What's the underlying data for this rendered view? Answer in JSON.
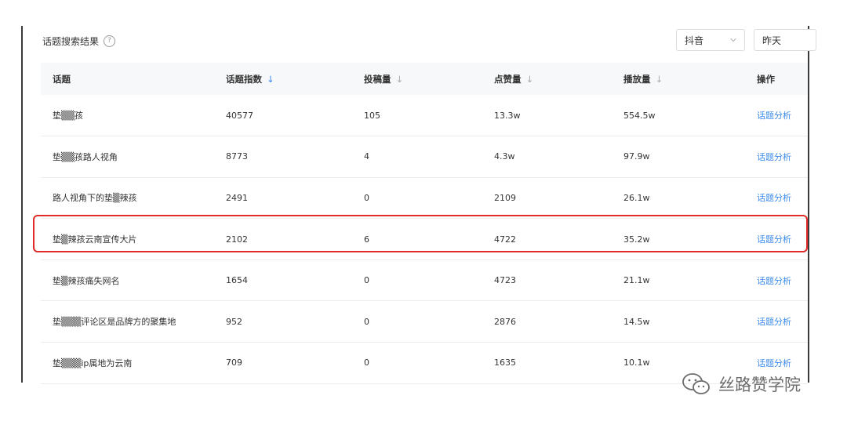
{
  "header": {
    "title": "话题搜索结果",
    "help_glyph": "?"
  },
  "filters": {
    "platform": "抖音",
    "date": "昨天"
  },
  "table": {
    "columns": [
      "话题",
      "话题指数",
      "投稿量",
      "点赞量",
      "播放量",
      "操作"
    ],
    "sort_glyph": "↓",
    "rows": [
      [
        "垫▒▒孩",
        "40577",
        "105",
        "13.3w",
        "554.5w",
        "话题分析"
      ],
      [
        "垫▒▒孩路人视角",
        "8773",
        "4",
        "4.3w",
        "97.9w",
        "话题分析"
      ],
      [
        "路人视角下的垫▒辣孩",
        "2491",
        "0",
        "2109",
        "26.1w",
        "话题分析"
      ],
      [
        "垫▒辣孩云南宣传大片",
        "2102",
        "6",
        "4722",
        "35.2w",
        "话题分析"
      ],
      [
        "垫▒辣孩痛失网名",
        "1654",
        "0",
        "4723",
        "21.1w",
        "话题分析"
      ],
      [
        "垫▒▒▒评论区是品牌方的聚集地",
        "952",
        "0",
        "2876",
        "14.5w",
        "话题分析"
      ],
      [
        "垫▒▒▒ip属地为云南",
        "709",
        "0",
        "1635",
        "10.1w",
        "话题分析"
      ]
    ]
  },
  "watermark": {
    "text": "丝路赞学院"
  },
  "colors": {
    "link": "#3b8beb",
    "highlight": "#e02b2b"
  }
}
